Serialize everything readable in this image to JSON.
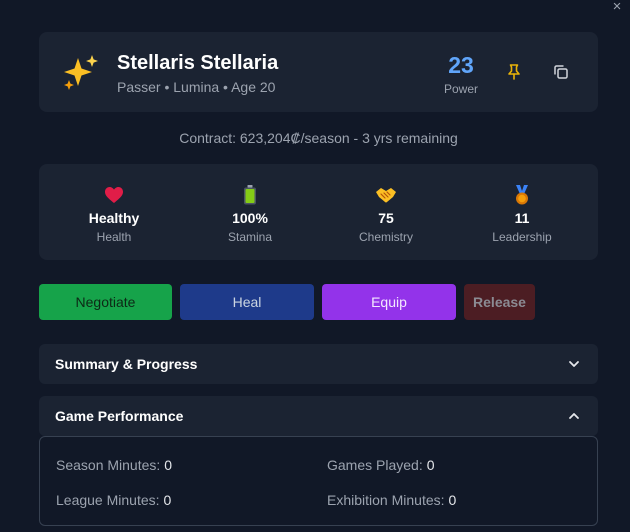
{
  "window": {
    "close_symbol": "×"
  },
  "player": {
    "name": "Stellaris Stellaria",
    "subtitle": "Passer • Lumina • Age 20",
    "avatar_icon": "sparkles-icon",
    "power_value": "23",
    "power_label": "Power",
    "contract": "Contract: 623,204₡/season - 3 yrs remaining"
  },
  "stats": [
    {
      "icon": "heart-icon",
      "value": "Healthy",
      "label": "Health"
    },
    {
      "icon": "battery-icon",
      "value": "100%",
      "label": "Stamina"
    },
    {
      "icon": "handshake-icon",
      "value": "75",
      "label": "Chemistry"
    },
    {
      "icon": "medal-icon",
      "value": "11",
      "label": "Leadership"
    }
  ],
  "actions": {
    "negotiate": "Negotiate",
    "heal": "Heal",
    "equip": "Equip",
    "release": "Release"
  },
  "sections": {
    "summary": {
      "title": "Summary & Progress",
      "expanded": false
    },
    "performance": {
      "title": "Game Performance",
      "expanded": true,
      "season_minutes_label": "Season Minutes:",
      "season_minutes": "0",
      "games_played_label": "Games Played:",
      "games_played": "0",
      "league_minutes_label": "League Minutes:",
      "league_minutes": "0",
      "exhibition_minutes_label": "Exhibition Minutes:",
      "exhibition_minutes": "0"
    }
  },
  "colors": {
    "background": "#111827",
    "card": "#1b2332",
    "power": "#60a5fa",
    "negotiate": "#16a34a",
    "heal": "#1e3a8a",
    "equip": "#9333ea",
    "release": "#4c1d23"
  }
}
